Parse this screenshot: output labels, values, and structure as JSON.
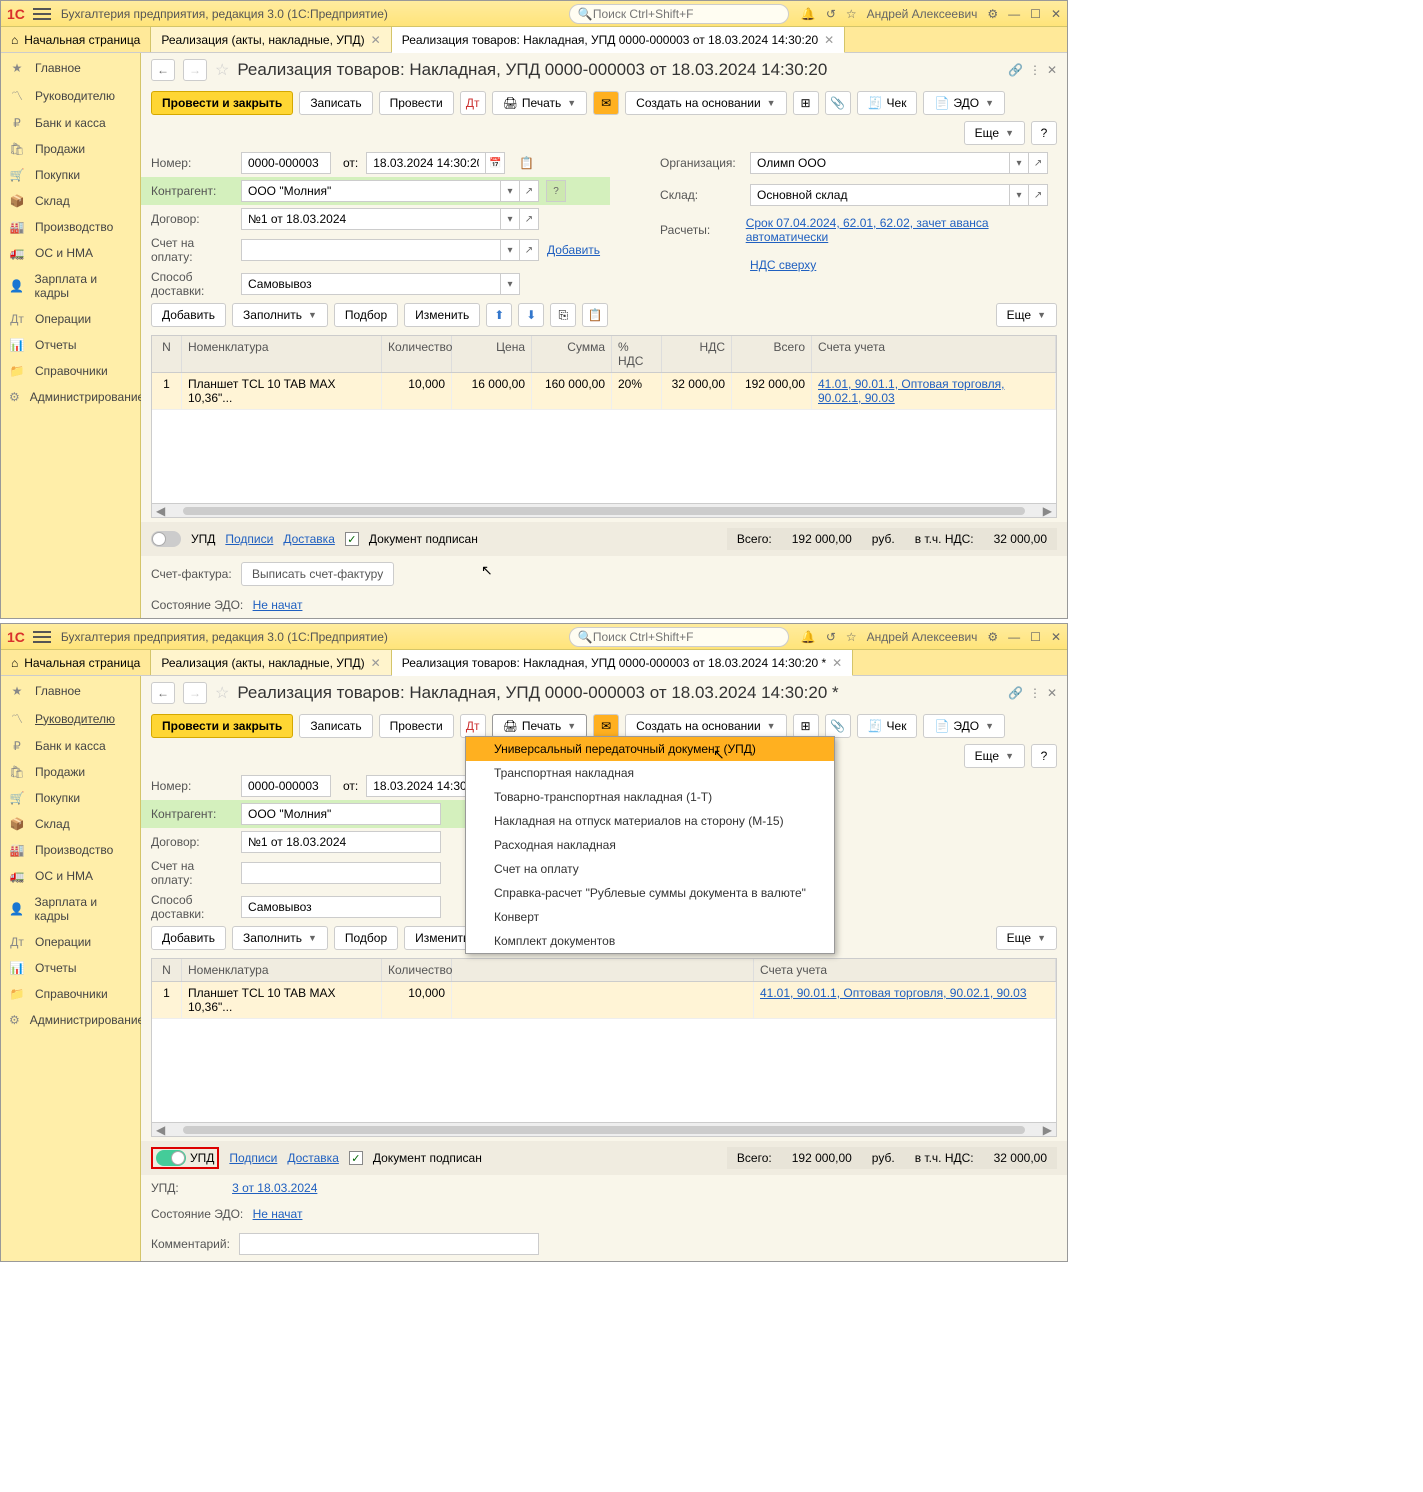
{
  "app": {
    "title": "Бухгалтерия предприятия, редакция 3.0  (1С:Предприятие)",
    "search_placeholder": "Поиск Ctrl+Shift+F",
    "user": "Андрей Алексеевич"
  },
  "tabs": {
    "home": "Начальная страница",
    "t1": "Реализация (акты, накладные, УПД)",
    "t2": "Реализация товаров: Накладная, УПД 0000-000003 от 18.03.2024 14:30:20",
    "t2_mod": "Реализация товаров: Накладная, УПД 0000-000003 от 18.03.2024 14:30:20 *"
  },
  "sidebar": {
    "items": [
      "Главное",
      "Руководителю",
      "Банк и касса",
      "Продажи",
      "Покупки",
      "Склад",
      "Производство",
      "ОС и НМА",
      "Зарплата и кадры",
      "Операции",
      "Отчеты",
      "Справочники",
      "Администрирование"
    ]
  },
  "page": {
    "title": "Реализация товаров: Накладная, УПД 0000-000003 от 18.03.2024 14:30:20",
    "title_mod": "Реализация товаров: Накладная, УПД 0000-000003 от 18.03.2024 14:30:20 *"
  },
  "toolbar": {
    "post_close": "Провести и закрыть",
    "write": "Записать",
    "post": "Провести",
    "print": "Печать",
    "create_based": "Создать на основании",
    "check": "Чек",
    "edo": "ЭДО",
    "more": "Еще"
  },
  "form": {
    "number_label": "Номер:",
    "number": "0000-000003",
    "from_label": "от:",
    "date": "18.03.2024 14:30:20",
    "org_label": "Организация:",
    "org": "Олимп ООО",
    "contr_label": "Контрагент:",
    "contr": "ООО \"Молния\"",
    "warehouse_label": "Склад:",
    "warehouse": "Основной склад",
    "contract_label": "Договор:",
    "contract": "№1 от 18.03.2024",
    "calc_label": "Расчеты:",
    "calc_link": "Срок 07.04.2024, 62.01, 62.02, зачет аванса автоматически",
    "invoice_label": "Счет на оплату:",
    "add_link": "Добавить",
    "vat_link": "НДС сверху",
    "delivery_label": "Способ доставки:",
    "delivery": "Самовывоз"
  },
  "table_toolbar": {
    "add": "Добавить",
    "fill": "Заполнить",
    "select": "Подбор",
    "change": "Изменить",
    "more": "Еще"
  },
  "table": {
    "headers": [
      "N",
      "Номенклатура",
      "Количество",
      "Цена",
      "Сумма",
      "% НДС",
      "НДС",
      "Всего",
      "Счета учета"
    ],
    "row": {
      "n": "1",
      "name": "Планшет TCL 10 TAB MAX 10,36\"...",
      "qty": "10,000",
      "price": "16 000,00",
      "sum": "160 000,00",
      "vat_pct": "20%",
      "vat": "32 000,00",
      "total": "192 000,00",
      "acct": "41.01, 90.01.1, Оптовая торговля, 90.02.1, 90.03"
    }
  },
  "footer": {
    "upd": "УПД",
    "sign": "Подписи",
    "delivery": "Доставка",
    "signed": "Документ подписан",
    "total_label": "Всего:",
    "total": "192 000,00",
    "rub": "руб.",
    "vat_incl": "в т.ч. НДС:",
    "vat_total": "32 000,00"
  },
  "invoice": {
    "label": "Счет-фактура:",
    "button": "Выписать счет-фактуру",
    "upd_label": "УПД:",
    "upd_link": "3 от 18.03.2024"
  },
  "edo_status": {
    "label": "Состояние ЭДО:",
    "value": "Не начат"
  },
  "comment": {
    "label": "Комментарий:"
  },
  "print_menu": {
    "items": [
      "Универсальный передаточный документ (УПД)",
      "Транспортная накладная",
      "Товарно-транспортная накладная (1-Т)",
      "Накладная на отпуск материалов на сторону (М-15)",
      "Расходная накладная",
      "Счет на оплату",
      "Справка-расчет \"Рублевые суммы документа в валюте\"",
      "Конверт",
      "Комплект документов"
    ]
  }
}
